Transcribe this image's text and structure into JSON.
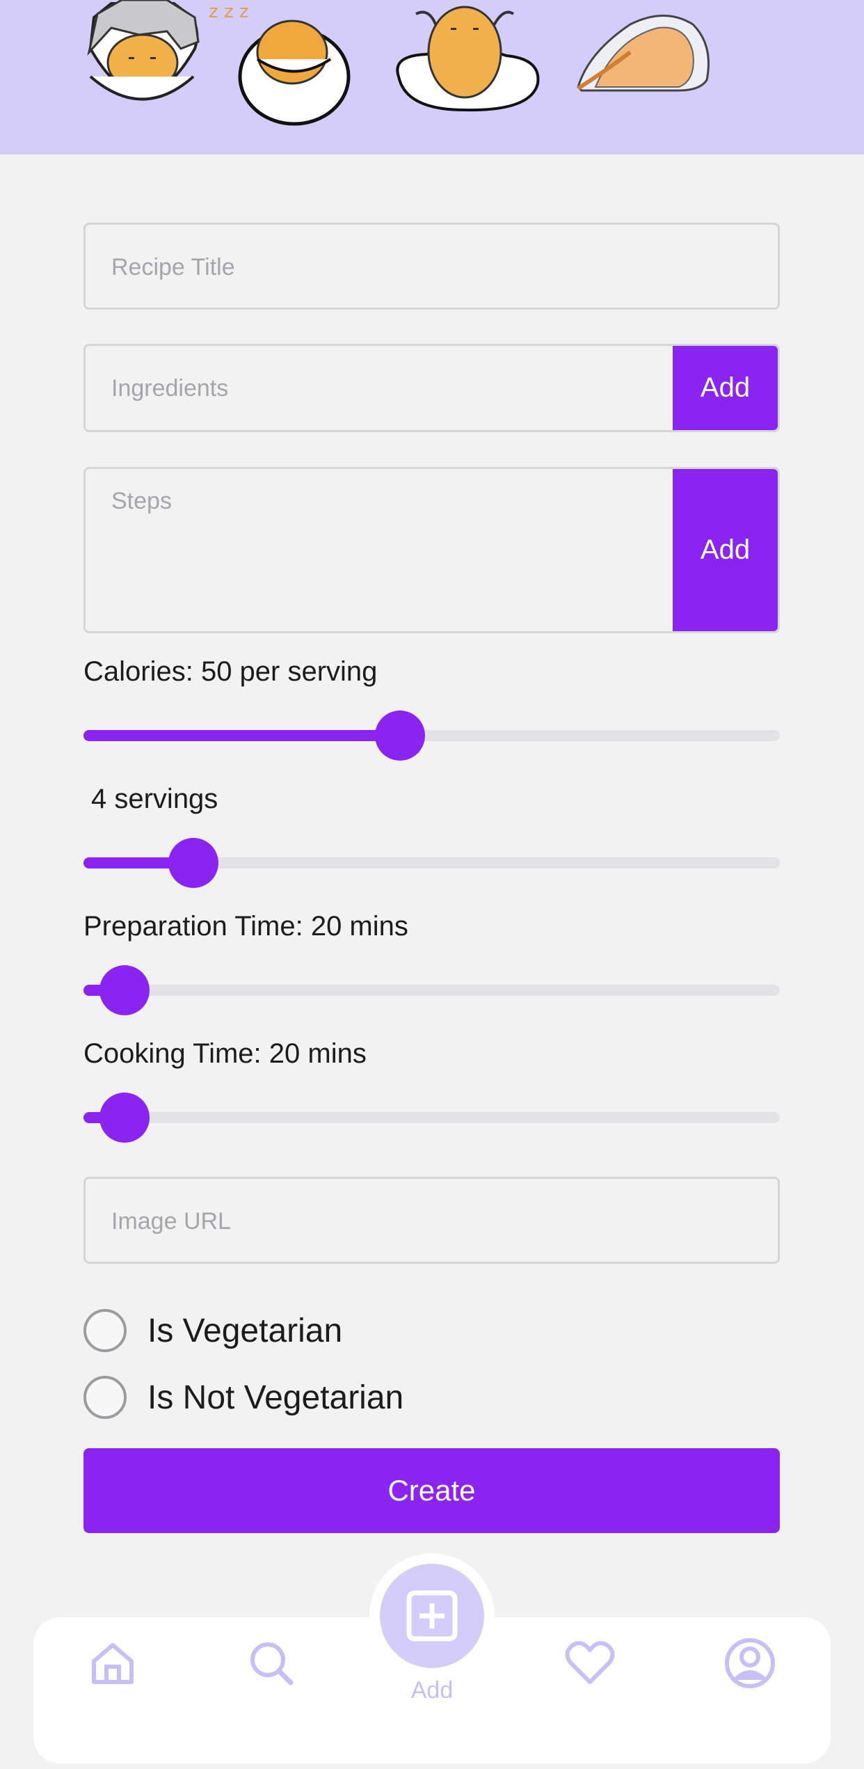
{
  "colors": {
    "accent": "#8b24f0",
    "banner": "#d4cdfa",
    "tab_icon": "#c9bff7",
    "background": "#f2f2f3"
  },
  "banner": {
    "mascots": [
      "egg-mascot-shell-hat",
      "egg-mascot-sleeping-in-shell",
      "egg-mascot-on-fried-egg",
      "egg-mascot-lying-under-egg-white"
    ]
  },
  "form": {
    "title_placeholder": "Recipe Title",
    "ingredients_placeholder": "Ingredients",
    "ingredients_add_label": "Add",
    "steps_placeholder": "Steps",
    "steps_add_label": "Add",
    "calories": {
      "label": "Calories: 50 per serving",
      "value_fraction": 0.455
    },
    "servings": {
      "label": "4 servings",
      "value_fraction": 0.158
    },
    "prep_time": {
      "label": "Preparation Time: 20 mins",
      "value_fraction": 0.059
    },
    "cook_time": {
      "label": "Cooking Time: 20 mins",
      "value_fraction": 0.059
    },
    "image_url_placeholder": "Image URL",
    "vegetarian_option": "Is Vegetarian",
    "not_vegetarian_option": "Is Not Vegetarian",
    "create_label": "Create"
  },
  "tabbar": {
    "items": [
      {
        "icon": "home-icon"
      },
      {
        "icon": "search-icon"
      },
      {
        "icon": "plus-square-icon",
        "label": "Add",
        "active": true
      },
      {
        "icon": "heart-icon"
      },
      {
        "icon": "user-circle-icon"
      }
    ]
  }
}
